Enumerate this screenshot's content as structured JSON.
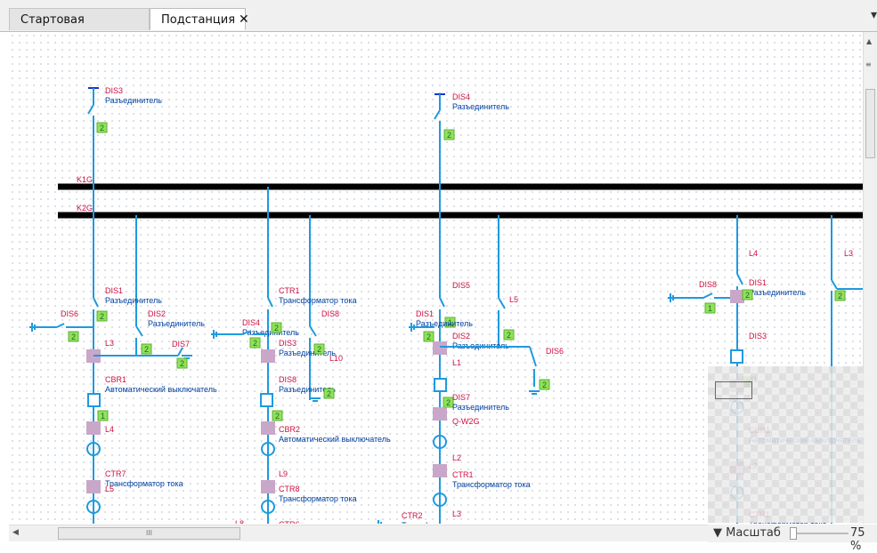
{
  "tabs": [
    {
      "label": "Стартовая страница",
      "active": false
    },
    {
      "label": "Подстанция",
      "active": true,
      "close": "✕"
    }
  ],
  "tab_menu_icon": "▾",
  "scrollbar": {
    "vertical_arrow": "▲",
    "grip": "≡",
    "horizontal_arrow": "◀",
    "thumb_grip": "III"
  },
  "scale": {
    "label": "▼ Масштаб",
    "value": "75 %"
  },
  "colors": {
    "line": "#1e9ae0",
    "label_red": "#d01040",
    "label_blue": "#0040a0",
    "bus": "#000000",
    "node_green": "#8fe25a",
    "node_pink": "#c9a7c9"
  },
  "scheme": {
    "buses": [
      {
        "name": "K1G"
      },
      {
        "name": "K2G"
      }
    ],
    "elements": [
      {
        "id": "DIS3",
        "desc": "Разъединитель"
      },
      {
        "id": "DIS4",
        "desc": "Разъединитель"
      },
      {
        "id": "DIS1",
        "desc": "Разъединитель"
      },
      {
        "id": "DIS2",
        "desc": "Разъединитель"
      },
      {
        "id": "DIS6",
        "desc": ""
      },
      {
        "id": "L3",
        "desc": ""
      },
      {
        "id": "DIS7",
        "desc": ""
      },
      {
        "id": "CBR1",
        "desc": "Автоматический выключатель"
      },
      {
        "id": "L4",
        "desc": ""
      },
      {
        "id": "CTR7",
        "desc": "Трансформатор тока"
      },
      {
        "id": "L5",
        "desc": ""
      },
      {
        "id": "CTR1",
        "desc": "Трансформатор тока"
      },
      {
        "id": "DIS4",
        "desc": "Разъединитель"
      },
      {
        "id": "DIS8",
        "desc": ""
      },
      {
        "id": "DIS3",
        "desc": "Разъединитель"
      },
      {
        "id": "L10",
        "desc": ""
      },
      {
        "id": "DIS8",
        "desc": "Разъединитель"
      },
      {
        "id": "CBR2",
        "desc": "Автоматический выключатель"
      },
      {
        "id": "L9",
        "desc": ""
      },
      {
        "id": "CTR8",
        "desc": "Трансформатор тока"
      },
      {
        "id": "L8",
        "desc": ""
      },
      {
        "id": "CTR6",
        "desc": "Трансформатор тока"
      },
      {
        "id": "DIS5",
        "desc": ""
      },
      {
        "id": "L5",
        "desc": ""
      },
      {
        "id": "DIS1",
        "desc": "Разъединитель"
      },
      {
        "id": "DIS2",
        "desc": "Разъединитель"
      },
      {
        "id": "DIS6",
        "desc": ""
      },
      {
        "id": "L1",
        "desc": ""
      },
      {
        "id": "DIS7",
        "desc": "Разъединитель"
      },
      {
        "id": "Q-W2G",
        "desc": ""
      },
      {
        "id": "L2",
        "desc": ""
      },
      {
        "id": "CTR1",
        "desc": "Трансформатор тока"
      },
      {
        "id": "L3",
        "desc": ""
      },
      {
        "id": "CTR2",
        "desc": "Трансформатор тока"
      },
      {
        "id": "L4",
        "desc": ""
      },
      {
        "id": "DIS8",
        "desc": ""
      },
      {
        "id": "DIS1",
        "desc": "Разъединитель"
      },
      {
        "id": "DIS3",
        "desc": ""
      },
      {
        "id": "L1",
        "desc": ""
      },
      {
        "id": "CBR1",
        "desc": "Автоматический выключатель"
      },
      {
        "id": "L2",
        "desc": ""
      },
      {
        "id": "CTR1",
        "desc": "Трансформатор тока"
      },
      {
        "id": "L3",
        "desc": ""
      },
      {
        "id": "CTR2",
        "desc": "Трансформатор тока"
      },
      {
        "id": "L4",
        "desc": ""
      },
      {
        "id": "DIS2",
        "desc": "Разъе"
      }
    ],
    "node_markers": [
      "2",
      "2",
      "2",
      "2",
      "2",
      "2",
      "1",
      "2",
      "2",
      "2",
      "2",
      "2",
      "1",
      "2",
      "2",
      "2",
      "2",
      "2",
      "1",
      "2",
      "2",
      "2"
    ]
  }
}
